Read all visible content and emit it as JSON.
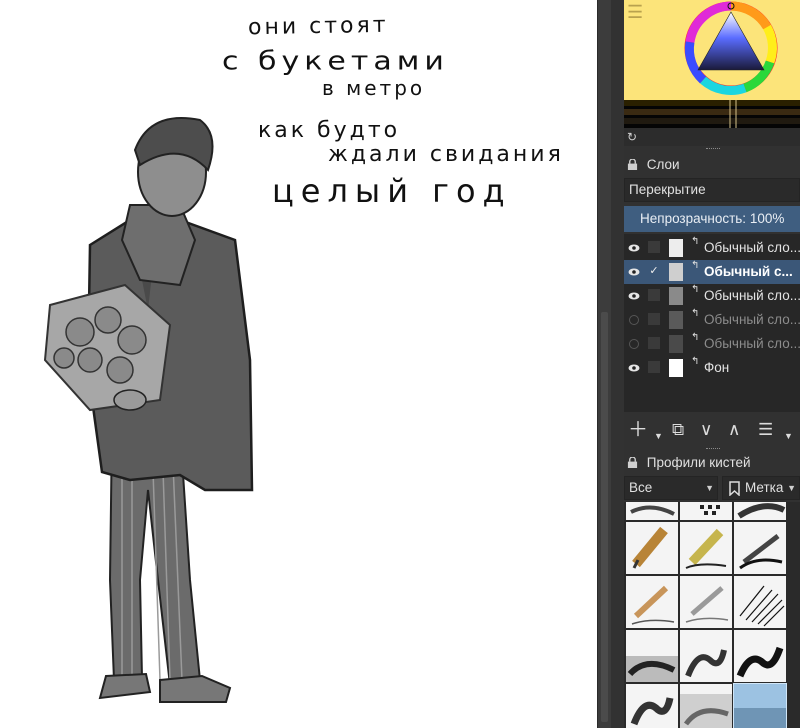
{
  "canvas": {
    "text_lines": [
      "они стоят",
      "с букетами",
      "в метро",
      "как будто",
      "ждали свидания",
      "целый год"
    ]
  },
  "panel": {
    "layers_header": "Слои",
    "blend_mode": "Перекрытие",
    "opacity_label": "Непрозрачность:",
    "opacity_value": "100%",
    "layers": [
      {
        "name": "Обычный сло...",
        "visible": true,
        "active": false
      },
      {
        "name": "Обычный с...",
        "visible": true,
        "active": true
      },
      {
        "name": "Обычный сло...",
        "visible": true,
        "active": false
      },
      {
        "name": "Обычный сло...",
        "visible": false,
        "active": false
      },
      {
        "name": "Обычный сло...",
        "visible": false,
        "active": false
      },
      {
        "name": "Фон",
        "visible": true,
        "active": false
      }
    ],
    "brush_header": "Профили кистей",
    "brush_filter": "Все",
    "brush_tag": "Метка",
    "icons": {
      "menu": "menu-icon",
      "refresh": "refresh-icon",
      "lock": "lock-icon",
      "eye": "eye-icon",
      "add": "plus-icon",
      "duplicate": "duplicate-icon",
      "move_down": "chevron-down-icon",
      "move_up": "chevron-up-icon",
      "properties": "sliders-icon",
      "bookmark": "bookmark-icon"
    },
    "colors": {
      "foreground": "#fce47a",
      "active_layer": "#3b5778",
      "opacity_bar": "#3f5e80"
    }
  }
}
